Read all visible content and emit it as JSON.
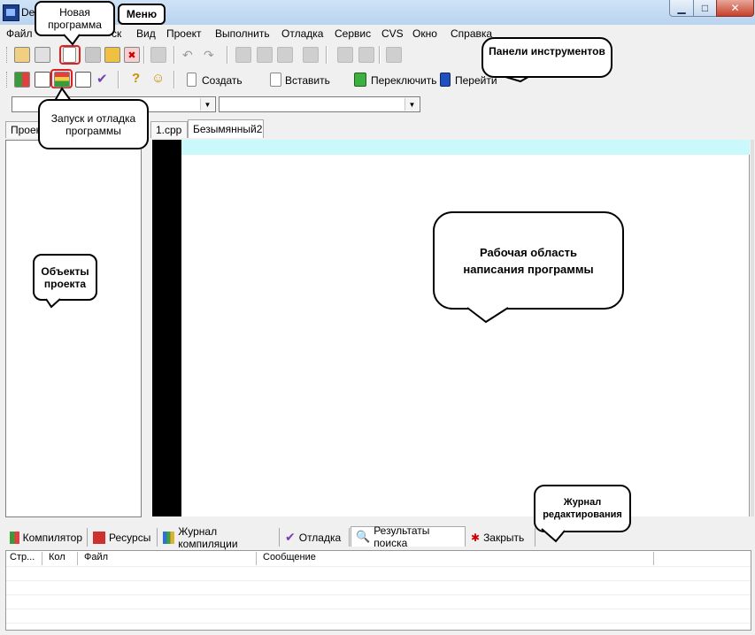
{
  "window": {
    "title": "De"
  },
  "menu": [
    "Файл",
    "ск",
    "Вид",
    "Проект",
    "Выполнить",
    "Отладка",
    "Сервис",
    "CVS",
    "Окно",
    "Справка"
  ],
  "toolbar": {
    "create_label": "Создать",
    "insert_label": "Вставить",
    "switch_label": "Переключить",
    "goto_label": "Перейти"
  },
  "panels": {
    "left_tab": "Проек",
    "editor_tabs": [
      "1.cpp",
      "Безымянный2"
    ]
  },
  "bottom_tabs": [
    "Компилятор",
    "Ресурсы",
    "Журнал компиляции",
    "Отладка",
    "Результаты поиска",
    "Закрыть"
  ],
  "grid_columns": [
    "Стр...",
    "Кол",
    "Файл",
    "Сообщение"
  ],
  "callouts": {
    "new_program": "Новая программа",
    "menu": "Меню",
    "toolbars": "Панели инструментов",
    "run_debug": "Запуск и отладка программы",
    "project_objects": "Объекты проекта",
    "work_area": "Рабочая область написания программы",
    "edit_log": "Журнал редактирования"
  },
  "colors": {
    "highlight_line": "#c9f9fb",
    "gutter": "#000000",
    "callout_red": "#e02020"
  }
}
